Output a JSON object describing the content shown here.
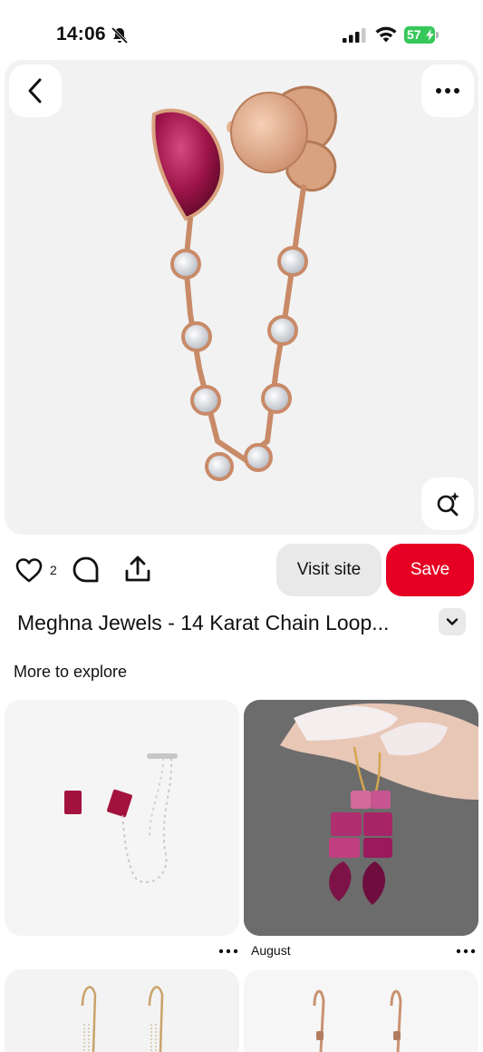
{
  "status_bar": {
    "time": "14:06",
    "battery_level": "57"
  },
  "pin": {
    "like_count": "2",
    "visit_label": "Visit site",
    "save_label": "Save",
    "title": "Meghna Jewels - 14 Karat Chain Loop..."
  },
  "explore": {
    "heading": "More to explore",
    "cards": [
      {
        "caption": ""
      },
      {
        "caption": "August"
      }
    ]
  },
  "colors": {
    "save_red": "#e60023",
    "visit_grey": "#e9e9e9",
    "battery_green": "#35c759"
  },
  "icons": [
    "back-icon",
    "more-icon",
    "visual-search-icon",
    "heart-icon",
    "comment-icon",
    "share-icon",
    "chevron-down-icon"
  ]
}
